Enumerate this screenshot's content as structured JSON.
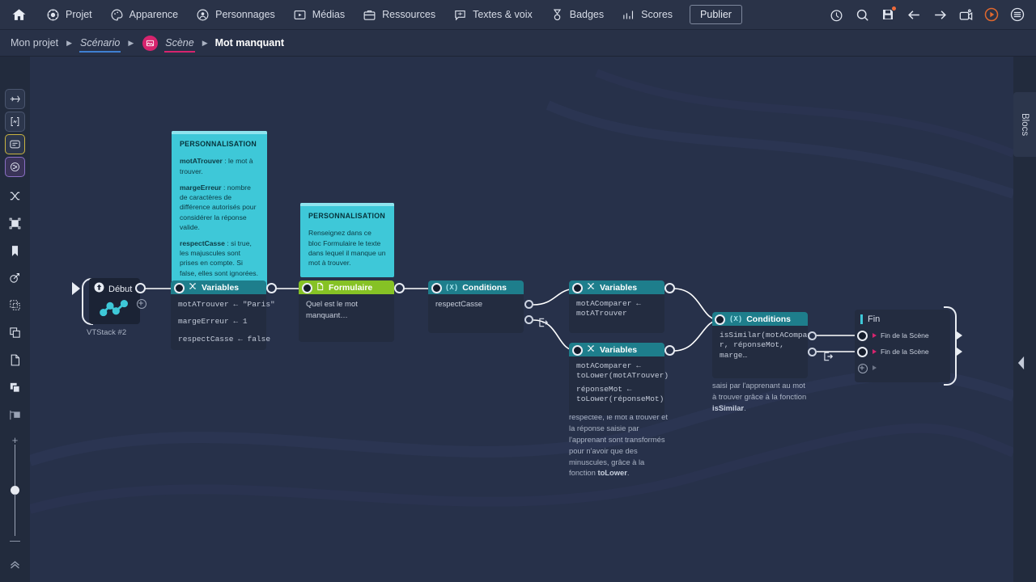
{
  "toolbar": {
    "home_icon": "home-icon",
    "items": [
      {
        "label": "Projet",
        "icon": "gear-icon"
      },
      {
        "label": "Apparence",
        "icon": "palette-icon"
      },
      {
        "label": "Personnages",
        "icon": "person-circle-icon"
      },
      {
        "label": "Médias",
        "icon": "media-icon"
      },
      {
        "label": "Ressources",
        "icon": "briefcase-icon"
      },
      {
        "label": "Textes & voix",
        "icon": "speech-bubble-icon"
      },
      {
        "label": "Badges",
        "icon": "badge-icon"
      },
      {
        "label": "Scores",
        "icon": "chart-icon"
      }
    ],
    "publish_label": "Publier",
    "right_buttons": [
      {
        "name": "check-circle-icon"
      },
      {
        "name": "search-icon"
      },
      {
        "name": "save-icon"
      },
      {
        "name": "arrow-left-icon"
      },
      {
        "name": "arrow-right-icon"
      },
      {
        "name": "camera-icon"
      },
      {
        "name": "play-circle-icon"
      },
      {
        "name": "menu-icon"
      }
    ]
  },
  "breadcrumb": {
    "project": "Mon projet",
    "scenario": "Scénario",
    "scene": "Scène",
    "current": "Mot manquant"
  },
  "left_rail": {
    "tools": [
      {
        "name": "pointer-node-icon",
        "state": "boxed"
      },
      {
        "name": "variable-node-icon",
        "state": "boxed"
      },
      {
        "name": "form-node-icon",
        "state": "selected-yellow"
      },
      {
        "name": "brain-node-icon",
        "state": "selected-purple"
      },
      {
        "name": "shuffle-icon",
        "state": "plain"
      },
      {
        "name": "frame-icon",
        "state": "plain"
      },
      {
        "name": "bookmark-icon",
        "state": "plain"
      },
      {
        "name": "target-icon",
        "state": "plain"
      },
      {
        "name": "duplicate-dashed-icon",
        "state": "plain"
      },
      {
        "name": "copy-icon",
        "state": "plain"
      },
      {
        "name": "page-icon",
        "state": "plain"
      },
      {
        "name": "layers-icon",
        "state": "plain"
      },
      {
        "name": "align-icon",
        "state": "plain"
      }
    ],
    "zoom_plus": "+",
    "zoom_minus": "—",
    "collapse_icon": "chevrons-up-icon"
  },
  "right_panel": {
    "tab_label": "Blocs"
  },
  "canvas": {
    "stack_label": "VTStack #2",
    "nodes": {
      "debut": {
        "title": "Début",
        "icon": "start-icon",
        "graph_icon": "node-graph-icon"
      },
      "variables1": {
        "title": "Variables",
        "icon": "shuffle-icon",
        "lines": [
          {
            "name": "motATrouver",
            "arrow": "←",
            "value": "\"Paris\""
          },
          {
            "name": "margeErreur",
            "arrow": "←",
            "value": "1"
          },
          {
            "name": "respectCasse",
            "arrow": "←",
            "value": "false"
          }
        ]
      },
      "formulaire": {
        "title": "Formulaire",
        "icon": "document-icon",
        "text": "Quel est le mot manquant…"
      },
      "conditions1": {
        "title": "Conditions",
        "icon": "braces-icon",
        "text": "respectCasse",
        "exit_icon": "exit-icon"
      },
      "variables2": {
        "title": "Variables",
        "icon": "shuffle-icon",
        "lines": [
          "motAComparer ←",
          "motATrouver"
        ]
      },
      "variables3": {
        "title": "Variables",
        "icon": "shuffle-icon",
        "lines": [
          "motAComparer ←",
          "toLower(motATrouver)",
          "réponseMot ←",
          "toLower(réponseMot)"
        ]
      },
      "conditions2": {
        "title": "Conditions",
        "icon": "braces-icon",
        "lines": [
          "isSimilar(motACompare",
          "r, réponseMot, marge…"
        ],
        "exit_icon": "exit-icon"
      },
      "fin": {
        "title": "Fin",
        "rows": [
          "Fin de la Scène",
          "Fin de la Scène"
        ]
      }
    },
    "sticky_notes": [
      {
        "heading": "PERSONNALISATION",
        "paragraphs": [
          {
            "bold": "motATrouver",
            "rest": " : le mot à trouver."
          },
          {
            "bold": "margeErreur",
            "rest": " : nombre de caractères de différence autorisés pour considérer la réponse valide."
          },
          {
            "bold": "respectCasse",
            "rest": " : si true, les majuscules sont prises en compte. Si false, elles sont ignorées."
          }
        ]
      },
      {
        "heading": "PERSONNALISATION",
        "paragraphs": [
          {
            "bold": "",
            "rest": "Renseignez dans ce bloc Formulaire le texte dans lequel il manque un mot à trouver."
          }
        ]
      }
    ],
    "notes": [
      "Si la casse n'a pas à être respectée, le mot à trouver et la réponse saisie par l'apprenant sont transformés pour n'avoir que des minuscules, grâce à la fonction toLower.",
      "Nous comparons ici le mot saisi par l'apprenant au mot à trouver grâce à la fonction isSimilar."
    ]
  },
  "colors": {
    "accent_teal": "#3ec8d8",
    "node_teal": "#1e7e8c",
    "node_green": "#86c225",
    "breadcrumb_pink": "#d6246e",
    "breadcrumb_blue": "#3f7fd1",
    "bg_canvas": "#27314a",
    "bg_chrome": "#222b3d"
  }
}
